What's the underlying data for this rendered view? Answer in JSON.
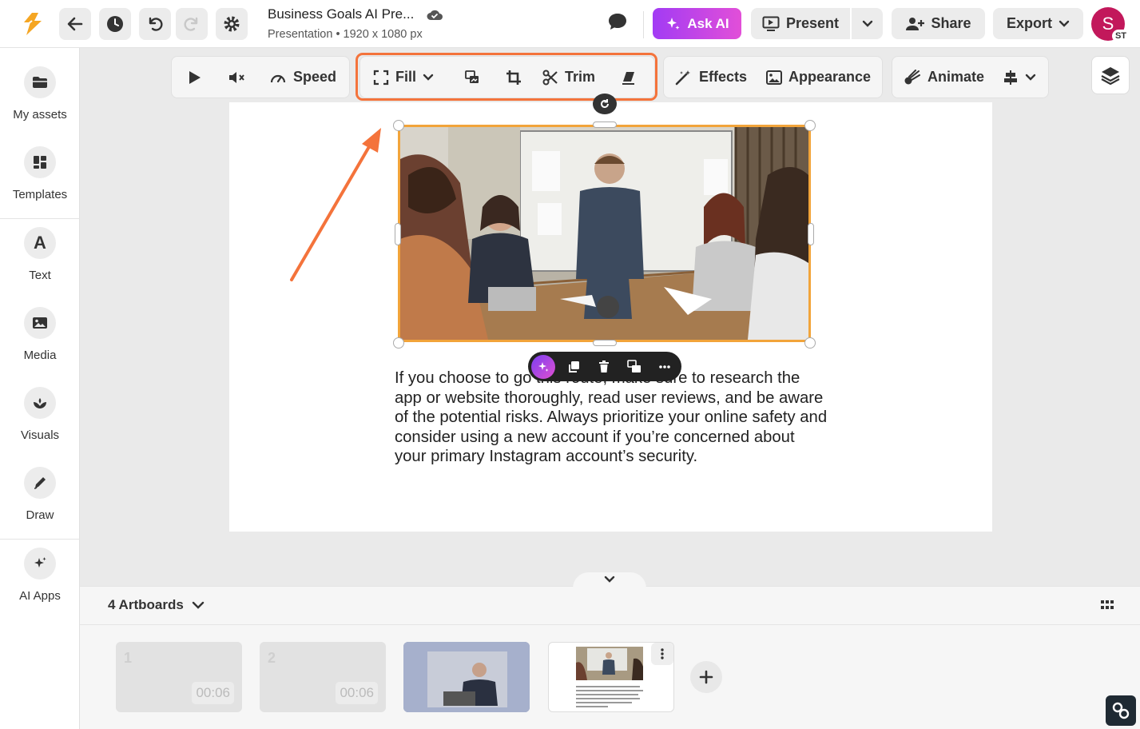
{
  "doc": {
    "title": "Business Goals AI Pre...",
    "subtitle": "Presentation • 1920 x 1080 px"
  },
  "header": {
    "ask_ai": "Ask AI",
    "present": "Present",
    "share": "Share",
    "export": "Export",
    "avatar_initial": "S",
    "avatar_badge": "ST"
  },
  "sidebar": {
    "items": [
      {
        "label": "My assets",
        "icon": "folder-icon"
      },
      {
        "label": "Templates",
        "icon": "templates-icon"
      },
      {
        "label": "Text",
        "icon": "text-icon"
      },
      {
        "label": "Media",
        "icon": "image-icon"
      },
      {
        "label": "Visuals",
        "icon": "visuals-icon"
      },
      {
        "label": "Draw",
        "icon": "pen-icon"
      },
      {
        "label": "AI Apps",
        "icon": "sparkle-icon"
      }
    ]
  },
  "toolbar": {
    "speed": "Speed",
    "fill": "Fill",
    "trim": "Trim",
    "effects": "Effects",
    "appearance": "Appearance",
    "animate": "Animate"
  },
  "canvas": {
    "body_text": "If you choose to go this route, make sure to research the app or website thoroughly, read user reviews, and be aware of the potential risks. Always prioritize your online safety and consider using a new account if you’re concerned about your primary Instagram account’s security."
  },
  "artboards": {
    "count_label": "4 Artboards",
    "thumbs": [
      {
        "num": "1",
        "duration": "00:06"
      },
      {
        "num": "2",
        "duration": "00:06"
      }
    ]
  },
  "colors": {
    "accent_orange": "#f4733b",
    "selection": "#f2a43a",
    "ask_ai_gradient_start": "#a23bf4",
    "ask_ai_gradient_end": "#e24fd8",
    "avatar": "#c2185b"
  }
}
